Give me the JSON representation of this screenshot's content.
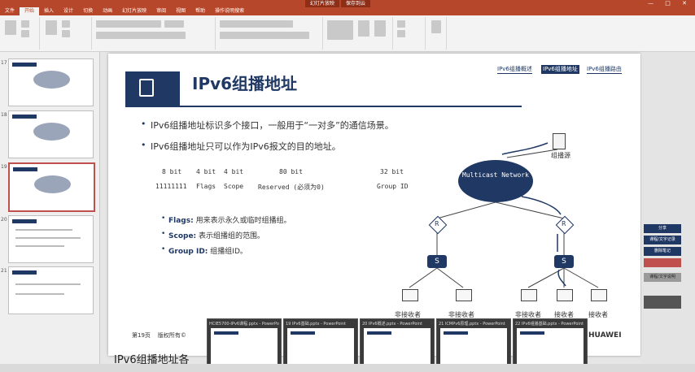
{
  "window": {
    "tabs": [
      "幻灯片放映",
      "保存到云"
    ],
    "controls": "— □ ✕"
  },
  "ribbon": {
    "tabs": [
      "文件",
      "开始",
      "插入",
      "设计",
      "切换",
      "动画",
      "幻灯片放映",
      "审阅",
      "视图",
      "帮助",
      "操作说明搜索"
    ],
    "active_tab": "开始"
  },
  "thumbnails": [
    {
      "num": "17"
    },
    {
      "num": "18"
    },
    {
      "num": "19"
    },
    {
      "num": "20"
    },
    {
      "num": "21"
    }
  ],
  "slide": {
    "title": "IPv6组播地址",
    "breadcrumbs": [
      "IPv6组播概述",
      "IPv6组播地址",
      "IPv6组播路由"
    ],
    "bullets": [
      "IPv6组播地址标识多个接口，一般用于“一对多”的通信场景。",
      "IPv6组播地址只可以作为IPv6报文的目的地址。"
    ],
    "header_sizes": [
      "8 bit",
      "4 bit",
      "4 bit",
      "80 bit",
      "32 bit"
    ],
    "header_fields": [
      "11111111",
      "Flags",
      "Scope",
      "Reserved (必须为0)",
      "Group ID"
    ],
    "sub_bullets": [
      {
        "key": "Flags:",
        "text": "用来表示永久或临时组播组。"
      },
      {
        "key": "Scope:",
        "text": "表示组播组的范围。"
      },
      {
        "key": "Group ID:",
        "text": "组播组ID。"
      }
    ],
    "diagram": {
      "source_label": "组播源",
      "cloud_label": "Multicast Network",
      "router_label": "R",
      "switch_label": "S",
      "hosts": [
        "非接收者",
        "非接收者",
        "非接收者",
        "接收者",
        "接收者"
      ]
    },
    "footer_page": "第19页",
    "footer_copyright": "版权所有©",
    "logo": "HUAWEI"
  },
  "right_panel": {
    "buttons": [
      "分享",
      "课程/文字记录",
      "删除笔记",
      "",
      "课程/文字说明"
    ]
  },
  "previews": [
    "HCIE5700-IPv6课程.pptx - PowerPoint",
    "19 IPv6基础.pptx - PowerPoint",
    "20 IPv6概述.pptx - PowerPoint",
    "21 ICMPv6原理.pptx - PowerPoint",
    "22 IPv6组播基础.pptx - PowerPoint"
  ],
  "subtitle": "IPv6组播地址各",
  "colors": {
    "accent": "#b7472a",
    "slide_navy": "#1f3864"
  }
}
